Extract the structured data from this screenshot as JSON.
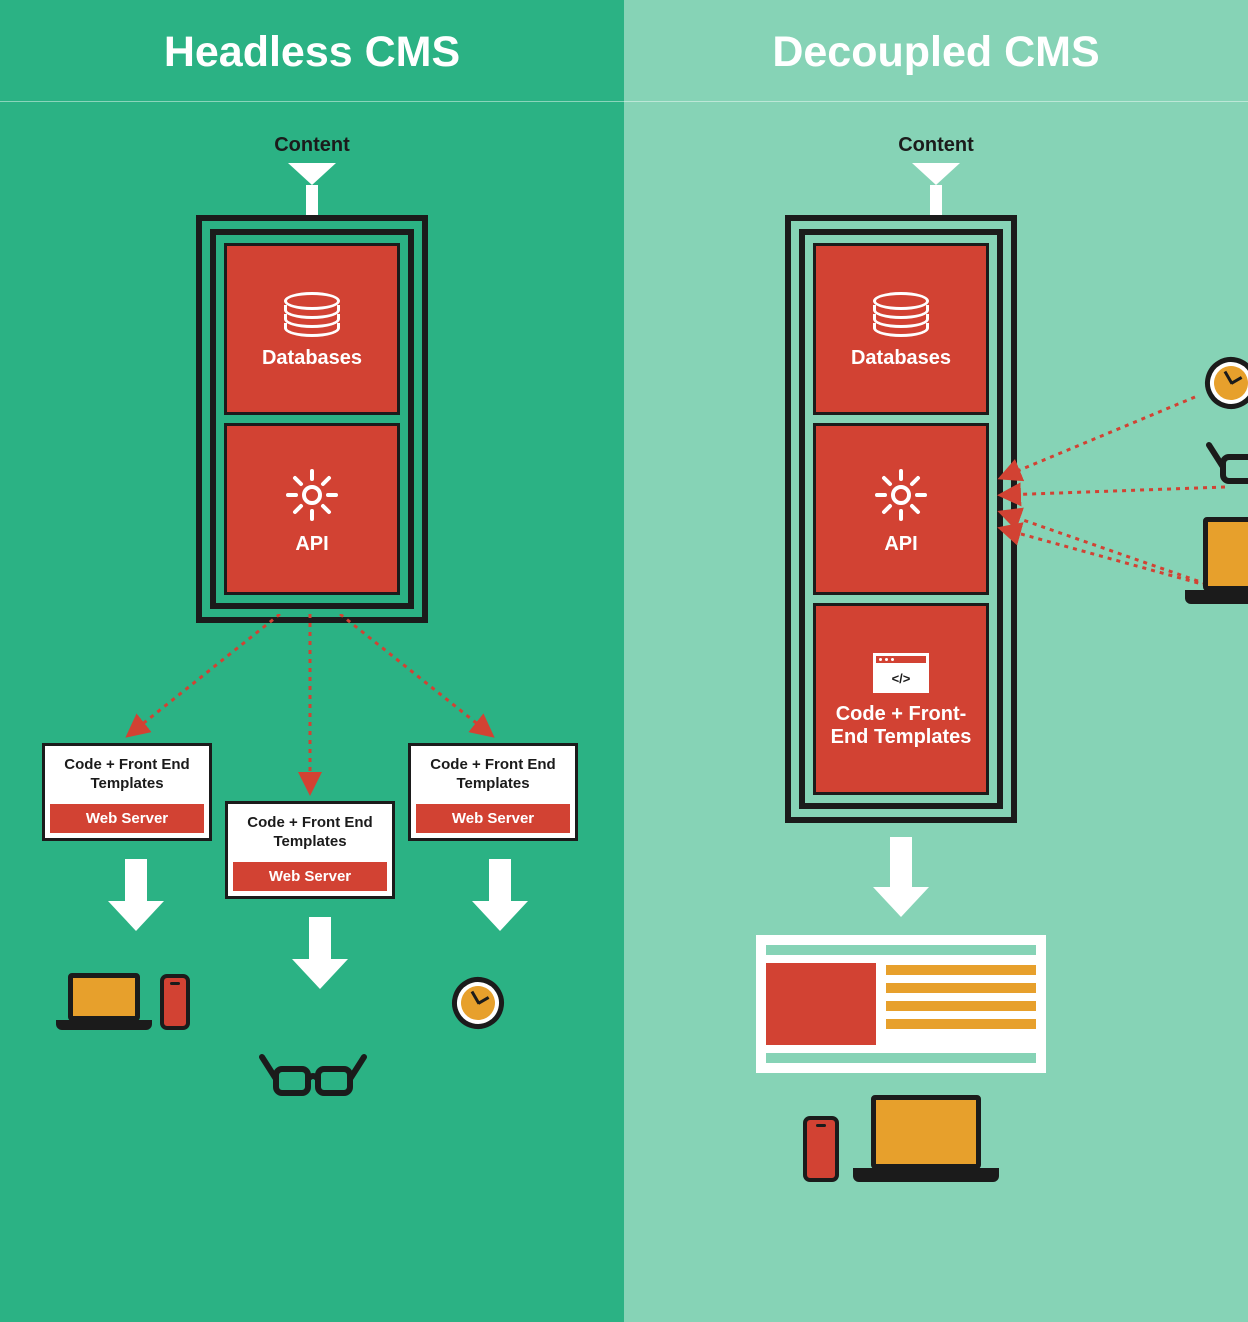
{
  "left": {
    "title": "Headless CMS",
    "content_label": "Content",
    "cards": {
      "db": "Databases",
      "api": "API"
    },
    "servers": [
      {
        "title": "Code + Front End Templates",
        "sub": "Web Server"
      },
      {
        "title": "Code + Front End Templates",
        "sub": "Web Server"
      },
      {
        "title": "Code + Front End Templates",
        "sub": "Web Server"
      }
    ]
  },
  "right": {
    "title": "Decoupled CMS",
    "content_label": "Content",
    "cards": {
      "db": "Databases",
      "api": "API",
      "fe": "Code + Front-End Templates"
    }
  },
  "colors": {
    "left_bg": "#2bb284",
    "right_bg": "#86d3b6",
    "red": "#d24233",
    "orange": "#e7a02c",
    "black": "#1b1b1b"
  }
}
